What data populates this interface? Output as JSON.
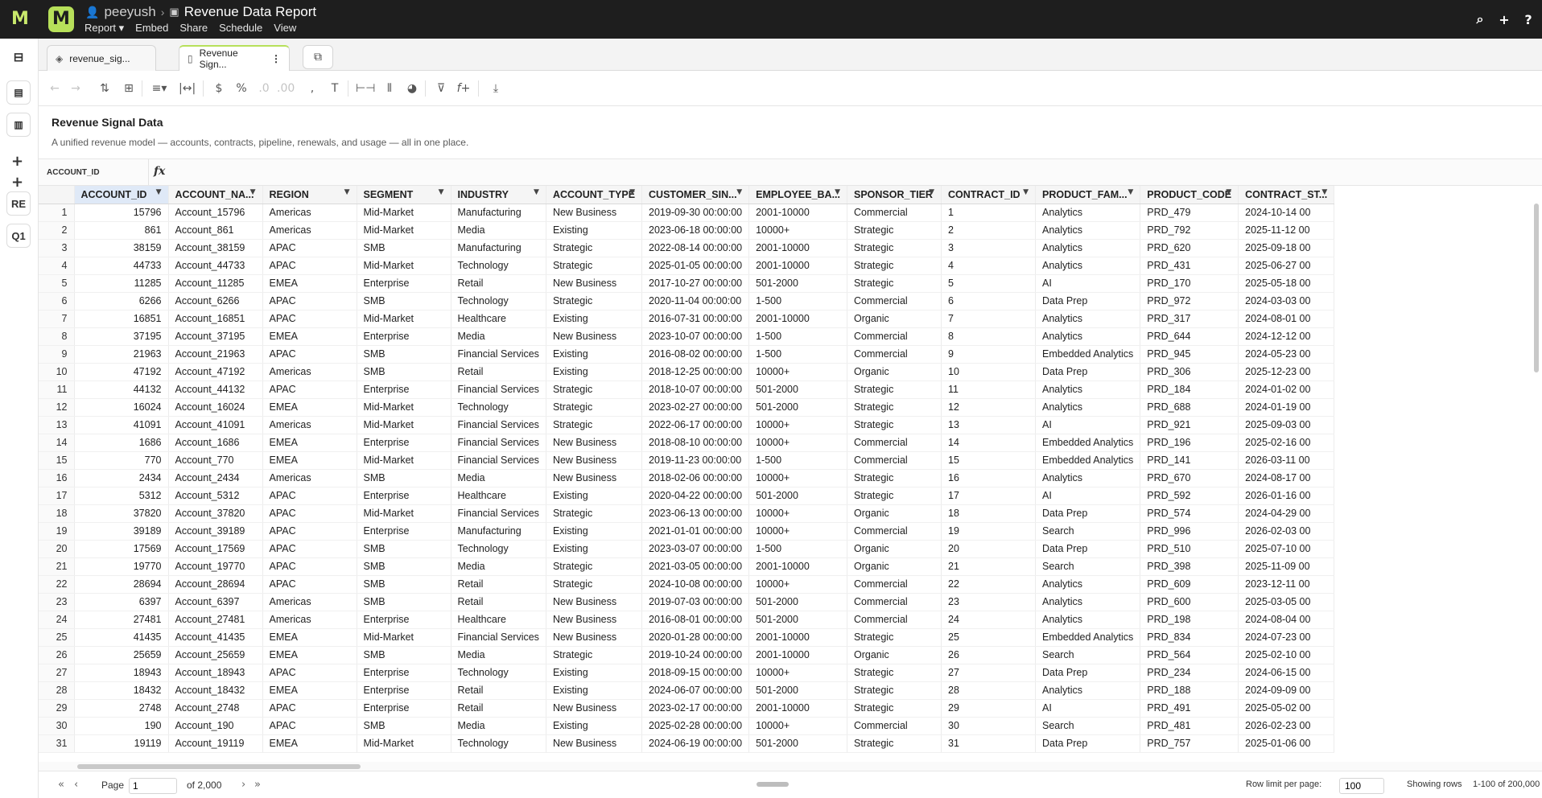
{
  "topbar": {
    "user": "peeyush",
    "report_title": "Revenue Data Report",
    "menus": [
      "Report ▾",
      "Embed",
      "Share",
      "Schedule",
      "View"
    ]
  },
  "rail": {
    "re_label": "RE",
    "q1_label": "Q1"
  },
  "tabs": [
    {
      "label": "revenue_sig..."
    },
    {
      "label": "Revenue Sign..."
    }
  ],
  "page": {
    "title": "Revenue Signal Data",
    "subtitle": "A unified revenue model — accounts, contracts, pipeline, renewals, and usage — all in one place."
  },
  "formula_bar": {
    "cell_name": "ACCOUNT_ID"
  },
  "grid": {
    "columns": [
      "ACCOUNT_ID",
      "ACCOUNT_NA...",
      "REGION",
      "SEGMENT",
      "INDUSTRY",
      "ACCOUNT_TYPE",
      "CUSTOMER_SIN...",
      "EMPLOYEE_BA...",
      "SPONSOR_TIER",
      "CONTRACT_ID",
      "PRODUCT_FAM...",
      "PRODUCT_CODE",
      "CONTRACT_ST..."
    ],
    "rows": [
      [
        "1",
        "15796",
        "Account_15796",
        "Americas",
        "Mid-Market",
        "Manufacturing",
        "New Business",
        "2019-09-30 00:00:00",
        "2001-10000",
        "Commercial",
        "1",
        "Analytics",
        "PRD_479",
        "2024-10-14 00"
      ],
      [
        "2",
        "861",
        "Account_861",
        "Americas",
        "Mid-Market",
        "Media",
        "Existing",
        "2023-06-18 00:00:00",
        "10000+",
        "Strategic",
        "2",
        "Analytics",
        "PRD_792",
        "2025-11-12 00"
      ],
      [
        "3",
        "38159",
        "Account_38159",
        "APAC",
        "SMB",
        "Manufacturing",
        "Strategic",
        "2022-08-14 00:00:00",
        "2001-10000",
        "Strategic",
        "3",
        "Analytics",
        "PRD_620",
        "2025-09-18 00"
      ],
      [
        "4",
        "44733",
        "Account_44733",
        "APAC",
        "Mid-Market",
        "Technology",
        "Strategic",
        "2025-01-05 00:00:00",
        "2001-10000",
        "Strategic",
        "4",
        "Analytics",
        "PRD_431",
        "2025-06-27 00"
      ],
      [
        "5",
        "11285",
        "Account_11285",
        "EMEA",
        "Enterprise",
        "Retail",
        "New Business",
        "2017-10-27 00:00:00",
        "501-2000",
        "Strategic",
        "5",
        "AI",
        "PRD_170",
        "2025-05-18 00"
      ],
      [
        "6",
        "6266",
        "Account_6266",
        "APAC",
        "SMB",
        "Technology",
        "Strategic",
        "2020-11-04 00:00:00",
        "1-500",
        "Commercial",
        "6",
        "Data Prep",
        "PRD_972",
        "2024-03-03 00"
      ],
      [
        "7",
        "16851",
        "Account_16851",
        "APAC",
        "Mid-Market",
        "Healthcare",
        "Existing",
        "2016-07-31 00:00:00",
        "2001-10000",
        "Organic",
        "7",
        "Analytics",
        "PRD_317",
        "2024-08-01 00"
      ],
      [
        "8",
        "37195",
        "Account_37195",
        "EMEA",
        "Enterprise",
        "Media",
        "New Business",
        "2023-10-07 00:00:00",
        "1-500",
        "Commercial",
        "8",
        "Analytics",
        "PRD_644",
        "2024-12-12 00"
      ],
      [
        "9",
        "21963",
        "Account_21963",
        "APAC",
        "SMB",
        "Financial Services",
        "Existing",
        "2016-08-02 00:00:00",
        "1-500",
        "Commercial",
        "9",
        "Embedded Analytics",
        "PRD_945",
        "2024-05-23 00"
      ],
      [
        "10",
        "47192",
        "Account_47192",
        "Americas",
        "SMB",
        "Retail",
        "Existing",
        "2018-12-25 00:00:00",
        "10000+",
        "Organic",
        "10",
        "Data Prep",
        "PRD_306",
        "2025-12-23 00"
      ],
      [
        "11",
        "44132",
        "Account_44132",
        "APAC",
        "Enterprise",
        "Financial Services",
        "Strategic",
        "2018-10-07 00:00:00",
        "501-2000",
        "Strategic",
        "11",
        "Analytics",
        "PRD_184",
        "2024-01-02 00"
      ],
      [
        "12",
        "16024",
        "Account_16024",
        "EMEA",
        "Mid-Market",
        "Technology",
        "Strategic",
        "2023-02-27 00:00:00",
        "501-2000",
        "Strategic",
        "12",
        "Analytics",
        "PRD_688",
        "2024-01-19 00"
      ],
      [
        "13",
        "41091",
        "Account_41091",
        "Americas",
        "Mid-Market",
        "Financial Services",
        "Strategic",
        "2022-06-17 00:00:00",
        "10000+",
        "Strategic",
        "13",
        "AI",
        "PRD_921",
        "2025-09-03 00"
      ],
      [
        "14",
        "1686",
        "Account_1686",
        "EMEA",
        "Enterprise",
        "Financial Services",
        "New Business",
        "2018-08-10 00:00:00",
        "10000+",
        "Commercial",
        "14",
        "Embedded Analytics",
        "PRD_196",
        "2025-02-16 00"
      ],
      [
        "15",
        "770",
        "Account_770",
        "EMEA",
        "Mid-Market",
        "Financial Services",
        "New Business",
        "2019-11-23 00:00:00",
        "1-500",
        "Commercial",
        "15",
        "Embedded Analytics",
        "PRD_141",
        "2026-03-11 00"
      ],
      [
        "16",
        "2434",
        "Account_2434",
        "Americas",
        "SMB",
        "Media",
        "New Business",
        "2018-02-06 00:00:00",
        "10000+",
        "Strategic",
        "16",
        "Analytics",
        "PRD_670",
        "2024-08-17 00"
      ],
      [
        "17",
        "5312",
        "Account_5312",
        "APAC",
        "Enterprise",
        "Healthcare",
        "Existing",
        "2020-04-22 00:00:00",
        "501-2000",
        "Strategic",
        "17",
        "AI",
        "PRD_592",
        "2026-01-16 00"
      ],
      [
        "18",
        "37820",
        "Account_37820",
        "APAC",
        "Mid-Market",
        "Financial Services",
        "Strategic",
        "2023-06-13 00:00:00",
        "10000+",
        "Organic",
        "18",
        "Data Prep",
        "PRD_574",
        "2024-04-29 00"
      ],
      [
        "19",
        "39189",
        "Account_39189",
        "APAC",
        "Enterprise",
        "Manufacturing",
        "Existing",
        "2021-01-01 00:00:00",
        "10000+",
        "Commercial",
        "19",
        "Search",
        "PRD_996",
        "2026-02-03 00"
      ],
      [
        "20",
        "17569",
        "Account_17569",
        "APAC",
        "SMB",
        "Technology",
        "Existing",
        "2023-03-07 00:00:00",
        "1-500",
        "Organic",
        "20",
        "Data Prep",
        "PRD_510",
        "2025-07-10 00"
      ],
      [
        "21",
        "19770",
        "Account_19770",
        "APAC",
        "SMB",
        "Media",
        "Strategic",
        "2021-03-05 00:00:00",
        "2001-10000",
        "Organic",
        "21",
        "Search",
        "PRD_398",
        "2025-11-09 00"
      ],
      [
        "22",
        "28694",
        "Account_28694",
        "APAC",
        "SMB",
        "Retail",
        "Strategic",
        "2024-10-08 00:00:00",
        "10000+",
        "Commercial",
        "22",
        "Analytics",
        "PRD_609",
        "2023-12-11 00"
      ],
      [
        "23",
        "6397",
        "Account_6397",
        "Americas",
        "SMB",
        "Retail",
        "New Business",
        "2019-07-03 00:00:00",
        "501-2000",
        "Commercial",
        "23",
        "Analytics",
        "PRD_600",
        "2025-03-05 00"
      ],
      [
        "24",
        "27481",
        "Account_27481",
        "Americas",
        "Enterprise",
        "Healthcare",
        "New Business",
        "2016-08-01 00:00:00",
        "501-2000",
        "Commercial",
        "24",
        "Analytics",
        "PRD_198",
        "2024-08-04 00"
      ],
      [
        "25",
        "41435",
        "Account_41435",
        "EMEA",
        "Mid-Market",
        "Financial Services",
        "New Business",
        "2020-01-28 00:00:00",
        "2001-10000",
        "Strategic",
        "25",
        "Embedded Analytics",
        "PRD_834",
        "2024-07-23 00"
      ],
      [
        "26",
        "25659",
        "Account_25659",
        "EMEA",
        "SMB",
        "Media",
        "Strategic",
        "2019-10-24 00:00:00",
        "2001-10000",
        "Organic",
        "26",
        "Search",
        "PRD_564",
        "2025-02-10 00"
      ],
      [
        "27",
        "18943",
        "Account_18943",
        "APAC",
        "Enterprise",
        "Technology",
        "Existing",
        "2018-09-15 00:00:00",
        "10000+",
        "Strategic",
        "27",
        "Data Prep",
        "PRD_234",
        "2024-06-15 00"
      ],
      [
        "28",
        "18432",
        "Account_18432",
        "EMEA",
        "Enterprise",
        "Retail",
        "Existing",
        "2024-06-07 00:00:00",
        "501-2000",
        "Strategic",
        "28",
        "Analytics",
        "PRD_188",
        "2024-09-09 00"
      ],
      [
        "29",
        "2748",
        "Account_2748",
        "APAC",
        "Enterprise",
        "Retail",
        "New Business",
        "2023-02-17 00:00:00",
        "2001-10000",
        "Strategic",
        "29",
        "AI",
        "PRD_491",
        "2025-05-02 00"
      ],
      [
        "30",
        "190",
        "Account_190",
        "APAC",
        "SMB",
        "Media",
        "Existing",
        "2025-02-28 00:00:00",
        "10000+",
        "Commercial",
        "30",
        "Search",
        "PRD_481",
        "2026-02-23 00"
      ],
      [
        "31",
        "19119",
        "Account_19119",
        "EMEA",
        "Mid-Market",
        "Technology",
        "New Business",
        "2024-06-19 00:00:00",
        "501-2000",
        "Strategic",
        "31",
        "Data Prep",
        "PRD_757",
        "2025-01-06 00"
      ]
    ]
  },
  "footer": {
    "page_label": "Page",
    "page_value": "1",
    "page_total": "of 2,000",
    "row_limit_label": "Row limit per page:",
    "row_limit_value": "100",
    "showing_label": "Showing rows",
    "showing_value": "1-100 of 200,000"
  },
  "colors": {
    "brand": "#b7e05a",
    "topbar": "#1e1e1e",
    "selected_header": "#dfe9f7"
  }
}
